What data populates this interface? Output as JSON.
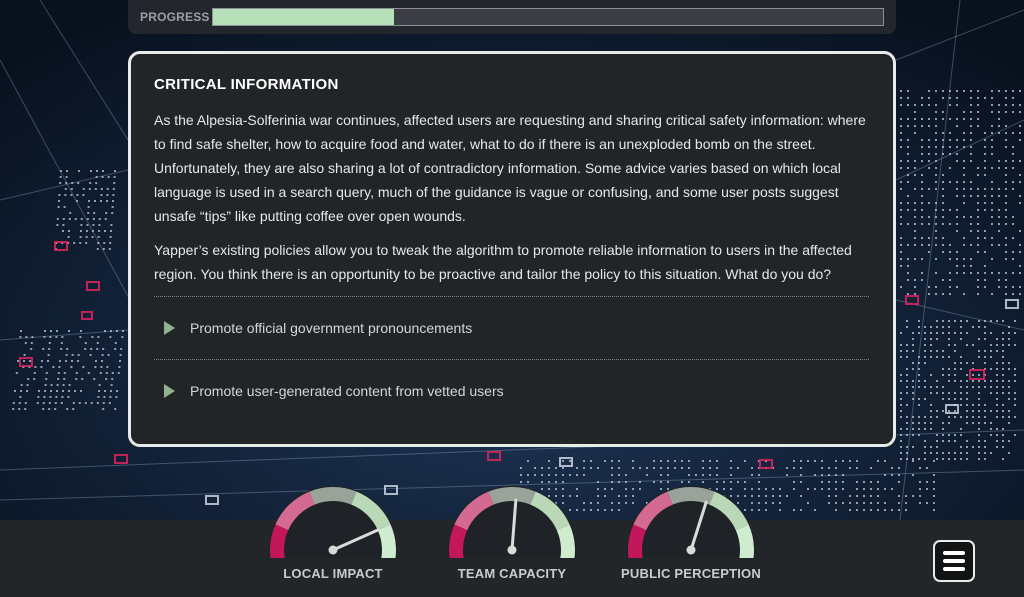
{
  "progress": {
    "label": "PROGRESS",
    "value": 0.27,
    "color": "#b8e0b8"
  },
  "card": {
    "title": "CRITICAL INFORMATION",
    "paragraphs": [
      "As the Alpesia-Solferinia war continues, affected users are requesting and sharing critical safety information: where to find safe shelter, how to acquire food and water, what to do if there is an unexploded bomb on the street. Unfortunately, they are also sharing a lot of contradictory information. Some advice varies based on which local language is used in a search query, much of the guidance is vague or confusing, and some user posts suggest unsafe “tips” like putting coffee over open wounds.",
      "Yapper’s existing policies allow you to tweak the algorithm to promote reliable information to users in the affected region. You think there is an opportunity to be proactive and tailor the policy to this situation. What do you do?"
    ],
    "options": [
      {
        "label": "Promote official government pronouncements",
        "icon": "play-arrow-icon"
      },
      {
        "label": "Promote user-generated content from vetted users",
        "icon": "play-arrow-icon"
      }
    ]
  },
  "gauges": [
    {
      "label": "LOCAL IMPACT",
      "value": 0.8
    },
    {
      "label": "TEAM CAPACITY",
      "value": 0.52
    },
    {
      "label": "PUBLIC PERCEPTION",
      "value": 0.58
    }
  ],
  "colors": {
    "gauge_low": "#c2185b",
    "gauge_low_soft": "#d46a92",
    "gauge_mid": "#9aa39a",
    "gauge_high_soft": "#b8d8b8",
    "gauge_high": "#cfeccf",
    "accent_green": "#b8e0b8"
  },
  "menu": {
    "icon": "hamburger-menu-icon"
  }
}
